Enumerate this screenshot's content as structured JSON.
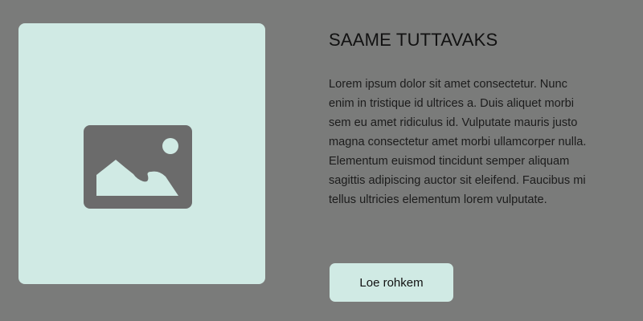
{
  "section": {
    "title": "SAAME TUTTAVAKS",
    "body": "Lorem ipsum dolor sit amet consectetur. Nunc enim in tristique id ultrices a. Duis aliquet morbi sem eu amet ridiculus id. Vulputate mauris justo magna consectetur amet morbi ullamcorper nulla. Elementum euismod tincidunt semper aliquam sagittis adipiscing auctor sit eleifend. Faucibus mi tellus ultricies elementum lorem vulputate.",
    "button_label": "Loe rohkem"
  },
  "media": {
    "icon": "image-placeholder-icon"
  },
  "colors": {
    "background": "#7a7b7a",
    "card": "#d0eae4",
    "icon": "#6b6b6b",
    "text": "#111111"
  }
}
